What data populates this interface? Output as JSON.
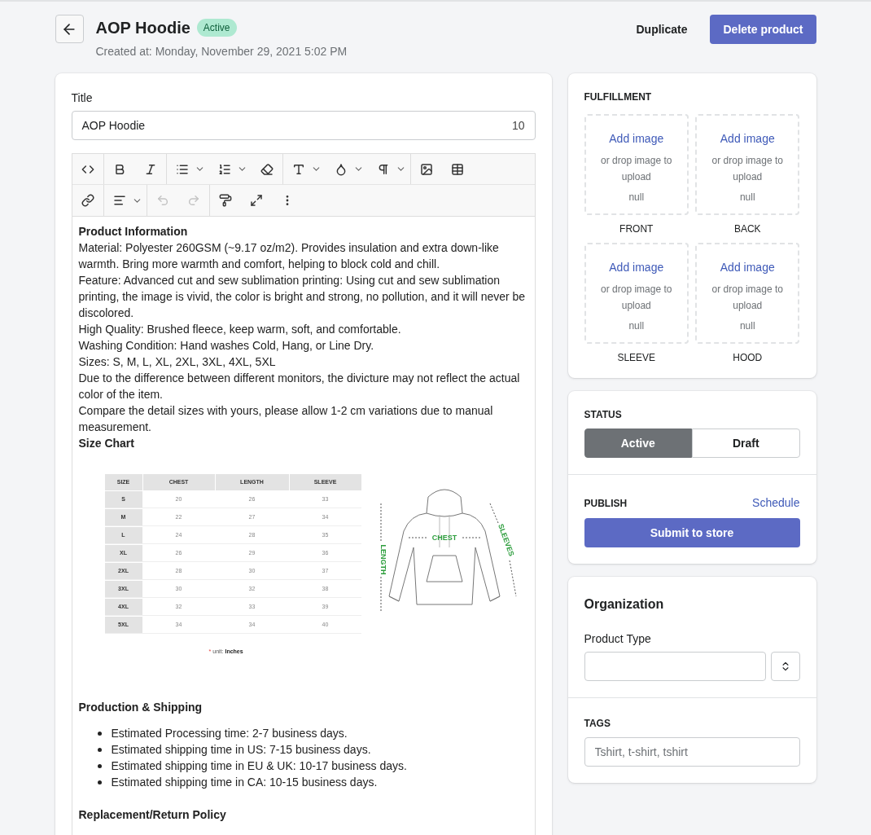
{
  "header": {
    "title": "AOP Hoodie",
    "badge": "Active",
    "created": "Created at: Monday, November 29, 2021 5:02 PM",
    "secondary_action": "Duplicate",
    "primary_action": "Delete product"
  },
  "title_field": {
    "label": "Title",
    "value": "AOP Hoodie",
    "count": "10"
  },
  "editor": {
    "history_buttons": [
      {
        "disabled": true
      },
      {
        "disabled": true
      }
    ],
    "blocks": [
      {
        "kind": "heading",
        "text": "Product Information"
      },
      {
        "kind": "paragraph",
        "text": "Material: Polyester 260GSM (~9.17 oz/m2). Provides insulation and extra down-like warmth. Bring more warmth and comfort, helping to block cold and chill."
      },
      {
        "kind": "paragraph",
        "text": "Feature: Advanced cut and sew sublimation printing: Using cut and sew sublimation printing, the image is vivid, the color is bright and strong, no pollution, and it will never be discolored."
      },
      {
        "kind": "paragraph",
        "text": "High Quality: Brushed fleece, keep warm, soft, and comfortable."
      },
      {
        "kind": "paragraph",
        "text": "Washing Condition: Hand washes Cold, Hang, or Line Dry."
      },
      {
        "kind": "paragraph",
        "text": "Sizes: S, M, L, XL, 2XL, 3XL, 4XL, 5XL"
      },
      {
        "kind": "paragraph",
        "text": "Due to the difference between different monitors, the divicture may not reflect the actual color of the item."
      },
      {
        "kind": "paragraph",
        "text": "Compare the detail sizes with yours, please allow 1-2 cm variations due to manual measurement."
      },
      {
        "kind": "heading",
        "text": "Size Chart"
      },
      {
        "kind": "size_chart",
        "columns": [
          "SIZE",
          "CHEST",
          "LENGTH",
          "SLEEVE"
        ],
        "rows": [
          [
            "S",
            "20",
            "26",
            "33"
          ],
          [
            "M",
            "22",
            "27",
            "34"
          ],
          [
            "L",
            "24",
            "28",
            "35"
          ],
          [
            "XL",
            "26",
            "29",
            "36"
          ],
          [
            "2XL",
            "28",
            "30",
            "37"
          ],
          [
            "3XL",
            "30",
            "32",
            "38"
          ],
          [
            "4XL",
            "32",
            "33",
            "39"
          ],
          [
            "5XL",
            "34",
            "34",
            "40"
          ]
        ],
        "unit": {
          "mark": "*",
          "label": "unit:",
          "value": "Inches"
        },
        "drawing_labels": {
          "chest": "CHEST",
          "length": "LENGTH",
          "sleeve": "SLEEVES"
        }
      },
      {
        "kind": "heading",
        "text": "Production & Shipping"
      },
      {
        "kind": "bullets",
        "items": [
          "Estimated Processing time: 2-7 business days.",
          "Estimated shipping time in US: 7-15 business days.",
          "Estimated shipping time in EU & UK: 10-17 business days.",
          "Estimated shipping time in CA: 10-15 business days."
        ]
      },
      {
        "kind": "heading",
        "text": "Replacement/Return Policy"
      }
    ]
  },
  "fulfillment": {
    "heading": "FULFILLMENT",
    "slots": [
      {
        "action": "Add image",
        "hint": "or drop image to upload",
        "value": "null",
        "label": "FRONT"
      },
      {
        "action": "Add image",
        "hint": "or drop image to upload",
        "value": "null",
        "label": "BACK"
      },
      {
        "action": "Add image",
        "hint": "or drop image to upload",
        "value": "null",
        "label": "SLEEVE"
      },
      {
        "action": "Add image",
        "hint": "or drop image to upload",
        "value": "null",
        "label": "HOOD"
      }
    ]
  },
  "status": {
    "heading": "STATUS",
    "options": [
      {
        "label": "Active",
        "selected": true
      },
      {
        "label": "Draft",
        "selected": false
      }
    ],
    "publish_heading": "PUBLISH",
    "schedule_link": "Schedule",
    "submit": "Submit to store"
  },
  "organization": {
    "heading": "Organization",
    "product_type_label": "Product Type",
    "tags_heading": "TAGS",
    "tags_placeholder": "Tshirt, t-shirt, tshirt"
  }
}
